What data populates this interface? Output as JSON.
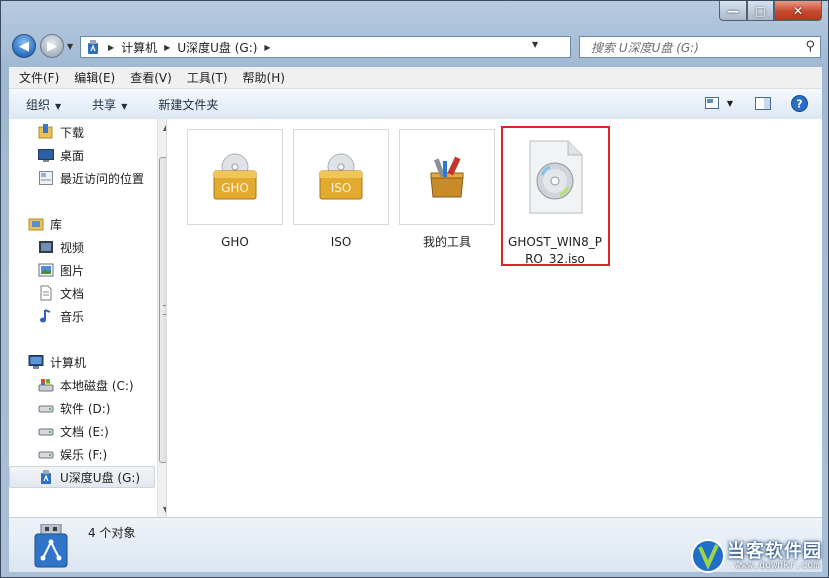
{
  "window": {
    "controls": {
      "minimize": "—",
      "maximize": "□",
      "close": "✕"
    }
  },
  "address": {
    "crumbs": [
      "计算机",
      "U深度U盘 (G:)"
    ]
  },
  "search": {
    "placeholder": "搜索 U深度U盘 (G:)"
  },
  "menubar": {
    "items": [
      "文件(F)",
      "编辑(E)",
      "查看(V)",
      "工具(T)",
      "帮助(H)"
    ]
  },
  "toolbar": {
    "organize": "组织",
    "share": "共享",
    "new_folder": "新建文件夹"
  },
  "sidebar": {
    "favorites": [
      {
        "label": "下载",
        "icon": "download-folder-icon"
      },
      {
        "label": "桌面",
        "icon": "desktop-icon"
      },
      {
        "label": "最近访问的位置",
        "icon": "recent-places-icon"
      }
    ],
    "libraries_label": "库",
    "libraries": [
      {
        "label": "视频",
        "icon": "video-library-icon"
      },
      {
        "label": "图片",
        "icon": "picture-library-icon"
      },
      {
        "label": "文档",
        "icon": "document-library-icon"
      },
      {
        "label": "音乐",
        "icon": "music-library-icon"
      }
    ],
    "computer_label": "计算机",
    "drives": [
      {
        "label": "本地磁盘 (C:)",
        "icon": "system-drive-icon"
      },
      {
        "label": "软件 (D:)",
        "icon": "drive-icon"
      },
      {
        "label": "文档 (E:)",
        "icon": "drive-icon"
      },
      {
        "label": "娱乐 (F:)",
        "icon": "drive-icon"
      },
      {
        "label": "U深度U盘 (G:)",
        "icon": "usb-drive-icon",
        "selected": true
      }
    ]
  },
  "files": [
    {
      "name": "GHO",
      "icon_text": "GHO",
      "type": "folder"
    },
    {
      "name": "ISO",
      "icon_text": "ISO",
      "type": "folder"
    },
    {
      "name": "我的工具",
      "type": "folder"
    },
    {
      "name": "GHOST_WIN8_PRO_32.iso",
      "type": "iso-file",
      "highlighted": true
    }
  ],
  "status": {
    "count_text": "4 个对象"
  },
  "watermark": {
    "name": "当客软件园",
    "url": "www.downkr.com"
  },
  "colors": {
    "highlight": "#d9252b",
    "accent": "#2a6fc2"
  }
}
